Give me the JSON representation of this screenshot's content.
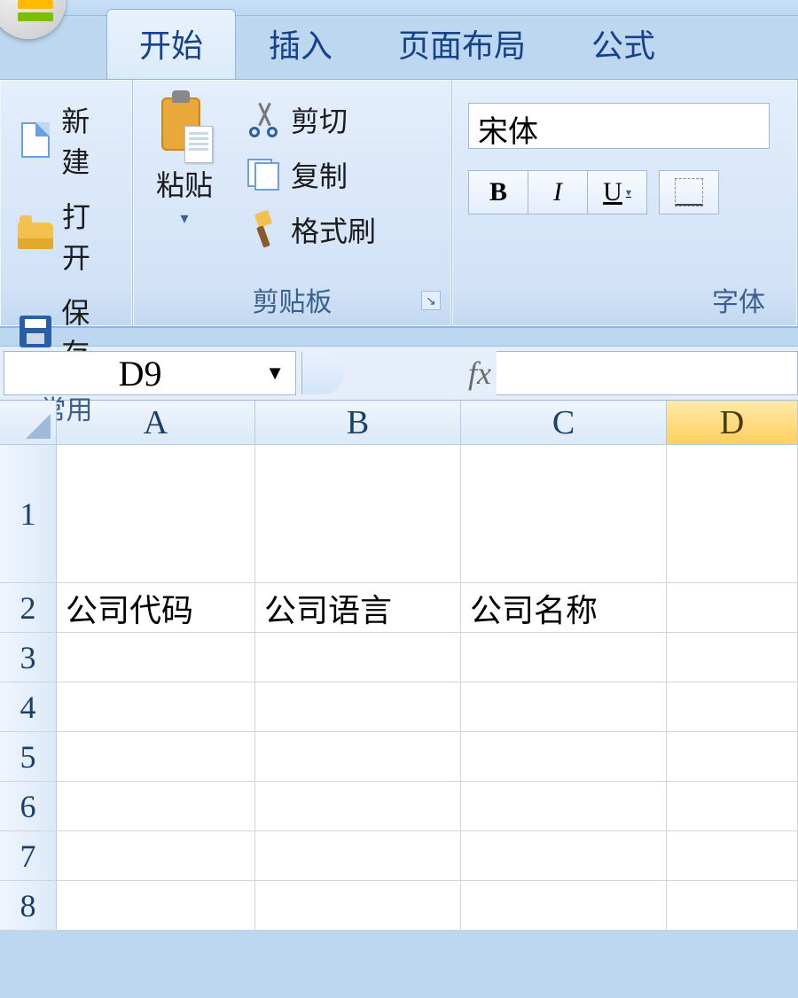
{
  "tabs": {
    "home": "开始",
    "insert": "插入",
    "layout": "页面布局",
    "formula": "公式"
  },
  "ribbon": {
    "common": {
      "label": "常用",
      "new_": "新建",
      "open": "打开",
      "save": "保存"
    },
    "clipboard": {
      "label": "剪贴板",
      "paste": "粘贴",
      "cut": "剪切",
      "copy": "复制",
      "format_painter": "格式刷"
    },
    "font": {
      "label": "字体",
      "family": "宋体"
    }
  },
  "formula_bar": {
    "name_box": "D9",
    "fx": "fx"
  },
  "sheet": {
    "columns": [
      "A",
      "B",
      "C",
      "D"
    ],
    "active_column": "D",
    "rows": [
      1,
      2,
      3,
      4,
      5,
      6,
      7,
      8
    ],
    "data": {
      "2": {
        "A": "公司代码",
        "B": "公司语言",
        "C": "公司名称"
      }
    }
  }
}
